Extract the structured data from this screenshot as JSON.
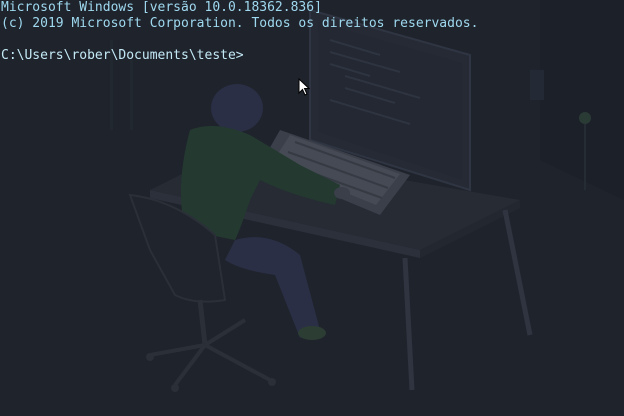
{
  "terminal": {
    "lines": [
      "Microsoft Windows [versão 10.0.18362.836]",
      "(c) 2019 Microsoft Corporation. Todos os direitos reservados.",
      "",
      "C:\\Users\\rober\\Documents\\teste>"
    ],
    "text_color": "#9fd9ef",
    "background_color": "#1f232c"
  },
  "mouse_pointer": {
    "icon": "arrow-cursor-icon"
  }
}
